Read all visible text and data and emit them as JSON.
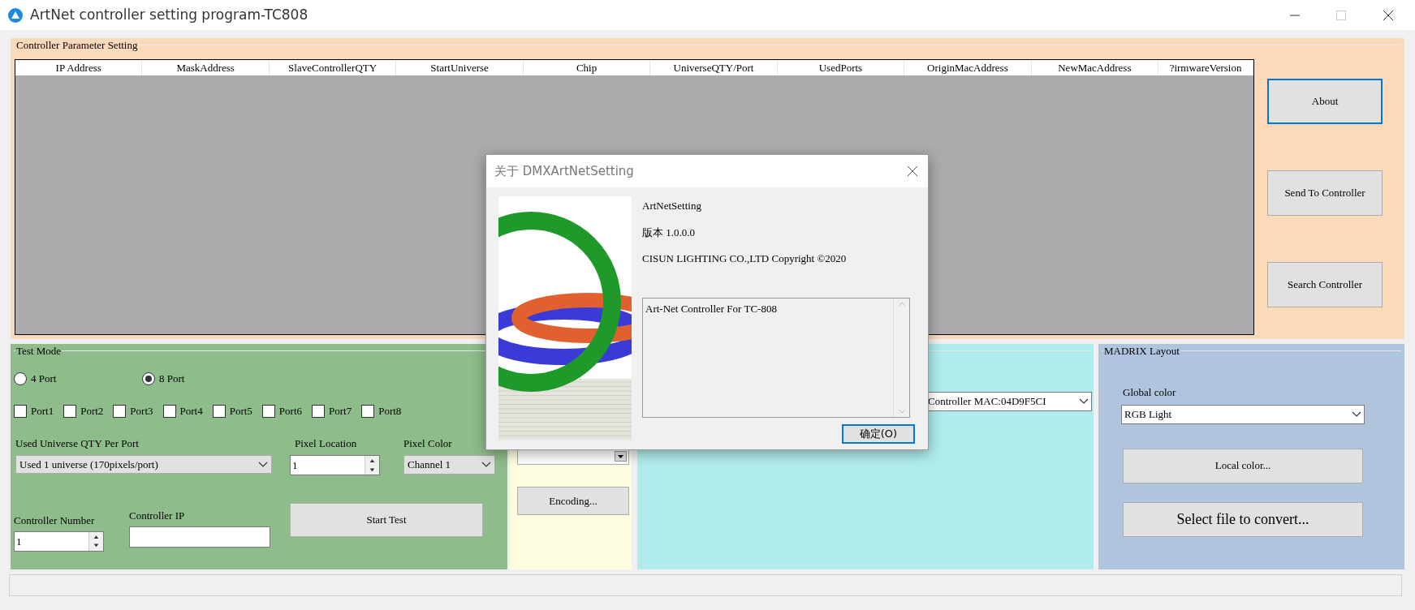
{
  "window": {
    "title": "ArtNet controller setting program-TC808"
  },
  "parameter_panel": {
    "title": "Controller Parameter Setting",
    "table": {
      "columns": [
        "IP Address",
        "MaskAddress",
        "SlaveControllerQTY",
        "StartUniverse",
        "Chip",
        "UniverseQTY/Port",
        "UsedPorts",
        "OriginMacAddress",
        "NewMacAddress",
        "?irmwareVersion"
      ]
    },
    "buttons": [
      {
        "label": "About",
        "focused": true
      },
      {
        "label": "Send To Controller",
        "focused": false
      },
      {
        "label": "Search Controller",
        "focused": false
      }
    ]
  },
  "test_mode": {
    "title": "Test Mode",
    "port_mode": [
      {
        "label": "4 Port",
        "selected": false
      },
      {
        "label": "8 Port",
        "selected": true
      }
    ],
    "ports": [
      {
        "label": "Port1",
        "checked": false
      },
      {
        "label": "Port2",
        "checked": false
      },
      {
        "label": "Port3",
        "checked": false
      },
      {
        "label": "Port4",
        "checked": false
      },
      {
        "label": "Port5",
        "checked": false
      },
      {
        "label": "Port6",
        "checked": false
      },
      {
        "label": "Port7",
        "checked": false
      },
      {
        "label": "Port8",
        "checked": false
      }
    ],
    "universe_qty": {
      "label": "Used Universe QTY Per Port",
      "value": "Used 1 universe (170pixels/port)"
    },
    "pixel_location": {
      "label": "Pixel Location",
      "value": "1"
    },
    "pixel_color": {
      "label": "Pixel Color",
      "value": "Channel 1"
    },
    "controller_number": {
      "label": "Controller Number",
      "value": "1"
    },
    "controller_ip": {
      "label": "Controller IP"
    },
    "start_button": "Start Test"
  },
  "encoding_panel": {
    "button": "Encoding..."
  },
  "mac_panel": {
    "combo_value": "Controller MAC:04D9F5CI"
  },
  "madrix": {
    "title": "MADRIX Layout",
    "global_color": {
      "label": "Global color",
      "value": "RGB Light"
    },
    "buttons": [
      "Local color...",
      "Select file to convert..."
    ]
  },
  "dialog": {
    "title": "关于 DMXArtNetSetting",
    "product": "ArtNetSetting",
    "version": "版本 1.0.0.0",
    "copyright": "CISUN LIGHTING CO.,LTD Copyright ©2020",
    "description": "Art-Net Controller For TC-808",
    "ok_button": {
      "label": "确定(O)",
      "focused": true
    }
  }
}
